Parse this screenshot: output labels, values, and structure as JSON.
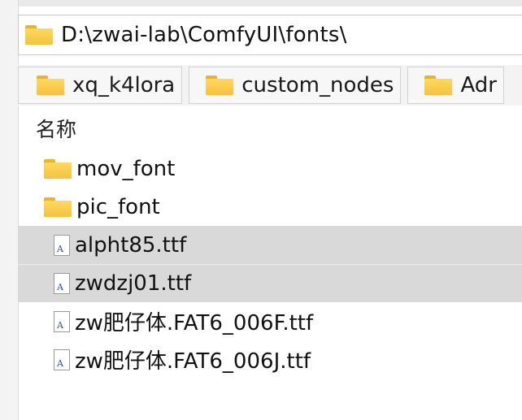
{
  "address_bar": {
    "path": "D:\\zwai-lab\\ComfyUI\\fonts\\"
  },
  "bookmarks": [
    {
      "label": "xq_k4lora"
    },
    {
      "label": "custom_nodes"
    },
    {
      "label": "Adr"
    }
  ],
  "file_list": {
    "column_header": "名称",
    "items": [
      {
        "name": "mov_font",
        "type": "folder",
        "selected": false
      },
      {
        "name": "pic_font",
        "type": "folder",
        "selected": false
      },
      {
        "name": "alpht85.ttf",
        "type": "font-file",
        "selected": true
      },
      {
        "name": "zwdzj01.ttf",
        "type": "font-file",
        "selected": true
      },
      {
        "name": "zw肥仔体.FAT6_006F.ttf",
        "type": "font-file",
        "selected": false
      },
      {
        "name": "zw肥仔体.FAT6_006J.ttf",
        "type": "font-file",
        "selected": false
      }
    ]
  },
  "icons": {
    "folder": "folder-icon",
    "font_file": "font-file-icon",
    "font_file_glyph": "A"
  },
  "colors": {
    "folder": "#f4c23d",
    "selection": "#d9d9d9",
    "font_glyph": "#2b4fa3"
  }
}
